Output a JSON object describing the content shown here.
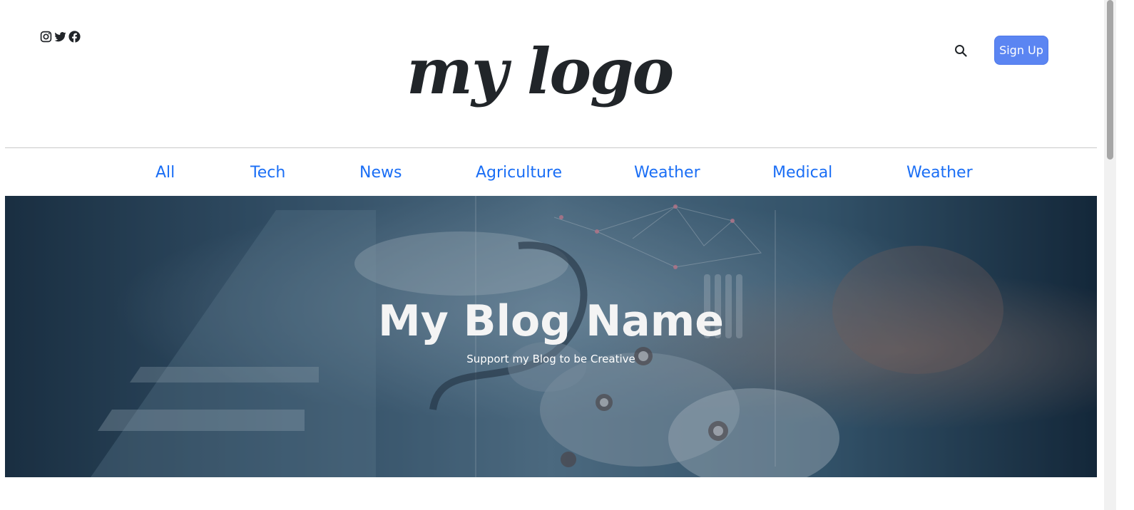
{
  "header": {
    "social_icons": [
      "instagram-icon",
      "twitter-icon",
      "facebook-icon"
    ],
    "logo_text": "my logo",
    "search_icon": "search-icon",
    "signup_label": "Sign Up"
  },
  "nav": {
    "items": [
      {
        "label": "All"
      },
      {
        "label": "Tech"
      },
      {
        "label": "News"
      },
      {
        "label": "Agriculture"
      },
      {
        "label": "Weather"
      },
      {
        "label": "Medical"
      },
      {
        "label": "Weather"
      }
    ]
  },
  "hero": {
    "title": "My Blog Name",
    "subtitle": "Support my Blog to be Creative"
  },
  "colors": {
    "accent": "#5b85f2",
    "link": "#1a6ef5",
    "text_dark": "#212529"
  }
}
